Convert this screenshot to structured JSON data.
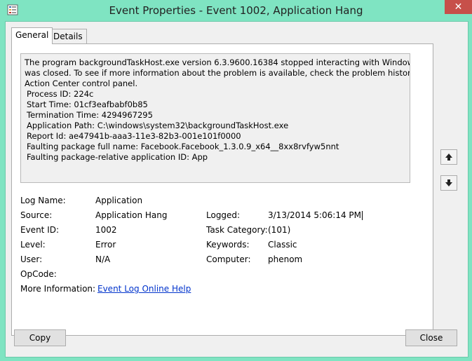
{
  "window": {
    "title": "Event Properties - Event 1002, Application Hang",
    "close_glyph": "✕"
  },
  "tabs": [
    {
      "label": "General",
      "active": true
    },
    {
      "label": "Details",
      "active": false
    }
  ],
  "description": {
    "intro": [
      "The program backgroundTaskHost.exe version 6.3.9600.16384 stopped interacting with Windows and",
      "was closed. To see if more information about the problem is available, check the problem history in the",
      "Action Center control panel."
    ],
    "details": [
      "Process ID: 224c",
      "Start Time: 01cf3eafbabf0b85",
      "Termination Time: 4294967295",
      "Application Path: C:\\windows\\system32\\backgroundTaskHost.exe",
      "Report Id: ae47941b-aaa3-11e3-82b3-001e101f0000",
      "Faulting package full name: Facebook.Facebook_1.3.0.9_x64__8xx8rvfyw5nnt",
      "Faulting package-relative application ID: App"
    ]
  },
  "fields": {
    "log_name": {
      "label": "Log Name:",
      "value": "Application"
    },
    "source": {
      "label": "Source:",
      "value": "Application Hang"
    },
    "logged": {
      "label": "Logged:",
      "value": "3/13/2014 5:06:14 PM"
    },
    "event_id": {
      "label": "Event ID:",
      "value": "1002"
    },
    "task_category": {
      "label": "Task Category:",
      "value": "(101)"
    },
    "level": {
      "label": "Level:",
      "value": "Error"
    },
    "keywords": {
      "label": "Keywords:",
      "value": "Classic"
    },
    "user": {
      "label": "User:",
      "value": "N/A"
    },
    "computer": {
      "label": "Computer:",
      "value": "phenom"
    },
    "opcode": {
      "label": "OpCode:",
      "value": ""
    },
    "more_info": {
      "label": "More Information:",
      "value": "Event Log Online Help"
    }
  },
  "buttons": {
    "copy": "Copy",
    "close": "Close"
  },
  "icons": {
    "app": "event-viewer-icon",
    "up": "arrow-up-icon",
    "down": "arrow-down-icon"
  },
  "colors": {
    "titlebar": "#7fe4c2",
    "close_button": "#c7504a",
    "link": "#0033cc"
  }
}
